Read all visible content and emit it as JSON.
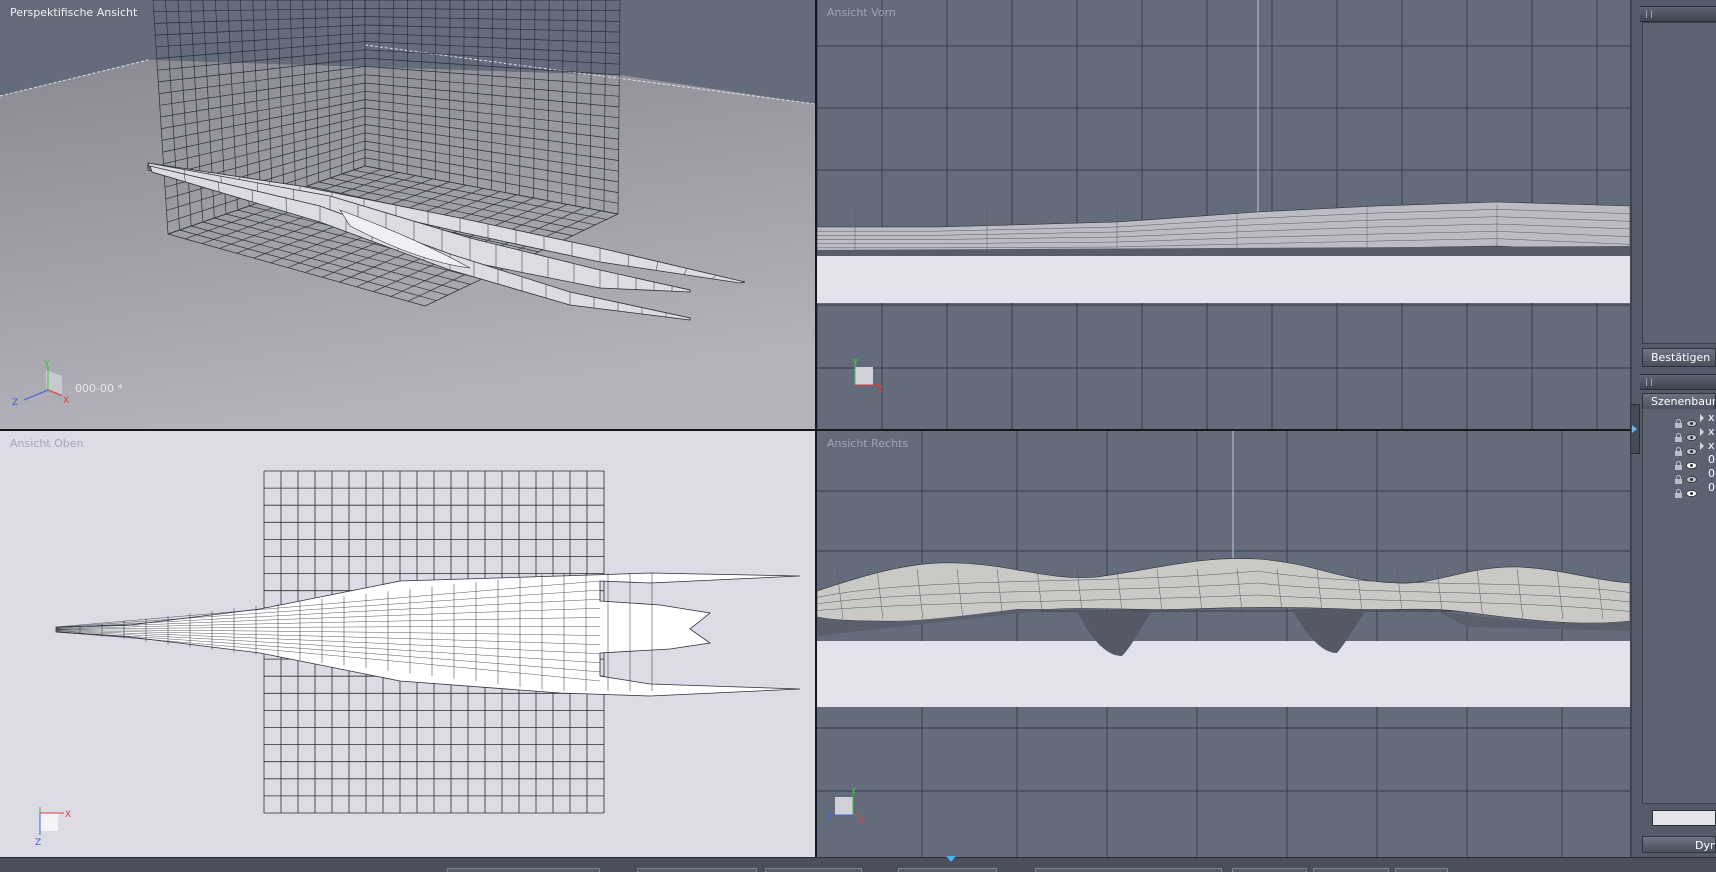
{
  "viewports": {
    "perspective": {
      "label": "Perspektifische Ansicht",
      "frame": "000-00 *"
    },
    "front": {
      "label": "Ansicht Vorn"
    },
    "top": {
      "label": "Ansicht Oben"
    },
    "right": {
      "label": "Ansicht Rechts"
    }
  },
  "axes": {
    "x": "X",
    "y": "Y",
    "z": "Z"
  },
  "panel": {
    "confirm_button": "Bestätigen",
    "scene_tab": "Szenenbaum",
    "dynamics_button": "Dyn",
    "tree_rows": [
      {
        "text": "x",
        "arrow": true,
        "eye": false
      },
      {
        "text": "x",
        "arrow": true,
        "eye": false
      },
      {
        "text": "x",
        "arrow": true,
        "eye": false
      },
      {
        "text": "0",
        "arrow": false,
        "eye": true
      },
      {
        "text": "0",
        "arrow": false,
        "eye": false
      },
      {
        "text": "0",
        "arrow": false,
        "eye": true
      }
    ]
  },
  "colors": {
    "viewport_bg": "#646b7a",
    "grid_line": "#3a3f4b",
    "floor": "#e3e1ec",
    "accent": "#4db0ea"
  }
}
